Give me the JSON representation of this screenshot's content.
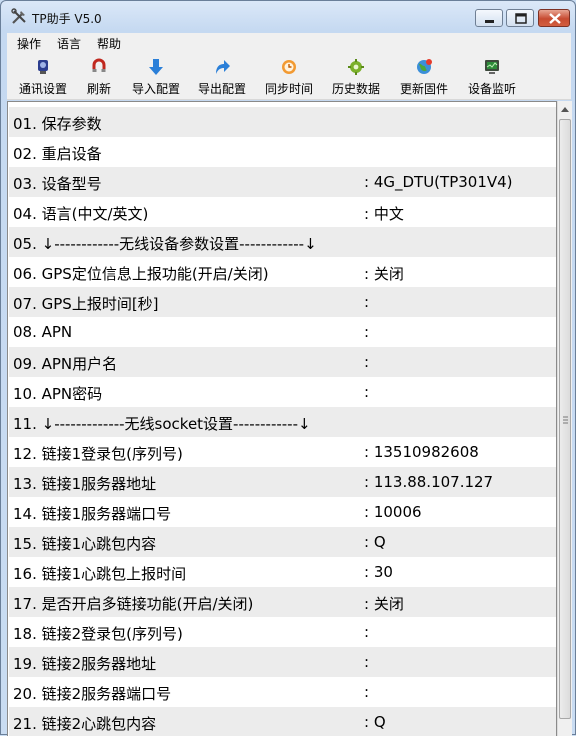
{
  "window": {
    "title": "TP助手 V5.0"
  },
  "menu": [
    "操作",
    "语言",
    "帮助"
  ],
  "toolbar": [
    {
      "label": "通讯设置",
      "icon": "plug-settings-icon"
    },
    {
      "label": "刷新",
      "icon": "refresh-magnet-icon"
    },
    {
      "label": "导入配置",
      "icon": "arrow-down-icon"
    },
    {
      "label": "导出配置",
      "icon": "arrow-up-right-icon"
    },
    {
      "label": "同步时间",
      "icon": "clock-sync-icon"
    },
    {
      "label": "历史数据",
      "icon": "history-gear-icon"
    },
    {
      "label": "更新固件",
      "icon": "globe-update-icon"
    },
    {
      "label": "设备监听",
      "icon": "monitor-icon"
    }
  ],
  "rows": [
    {
      "name": "01. 保存参数",
      "value": ""
    },
    {
      "name": "02. 重启设备",
      "value": ""
    },
    {
      "name": "03. 设备型号",
      "value": ": 4G_DTU(TP301V4)"
    },
    {
      "name": "04. 语言(中文/英文)",
      "value": ": 中文"
    },
    {
      "name": "05. ↓------------无线设备参数设置------------↓",
      "value": ""
    },
    {
      "name": "06. GPS定位信息上报功能(开启/关闭)",
      "value": ": 关闭"
    },
    {
      "name": "07. GPS上报时间[秒]",
      "value": ":"
    },
    {
      "name": "08. APN",
      "value": ":"
    },
    {
      "name": "09. APN用户名",
      "value": ":"
    },
    {
      "name": "10. APN密码",
      "value": ":"
    },
    {
      "name": "11. ↓-------------无线socket设置------------↓",
      "value": ""
    },
    {
      "name": "12. 链接1登录包(序列号)",
      "value": ": 13510982608"
    },
    {
      "name": "13. 链接1服务器地址",
      "value": ": 113.88.107.127"
    },
    {
      "name": "14. 链接1服务器端口号",
      "value": ": 10006"
    },
    {
      "name": "15. 链接1心跳包内容",
      "value": ": Q"
    },
    {
      "name": "16. 链接1心跳包上报时间",
      "value": ": 30"
    },
    {
      "name": "17. 是否开启多链接功能(开启/关闭)",
      "value": ": 关闭"
    },
    {
      "name": "18. 链接2登录包(序列号)",
      "value": ":"
    },
    {
      "name": "19. 链接2服务器地址",
      "value": ":"
    },
    {
      "name": "20. 链接2服务器端口号",
      "value": ":"
    },
    {
      "name": "21. 链接2心跳包内容",
      "value": ": Q"
    }
  ]
}
